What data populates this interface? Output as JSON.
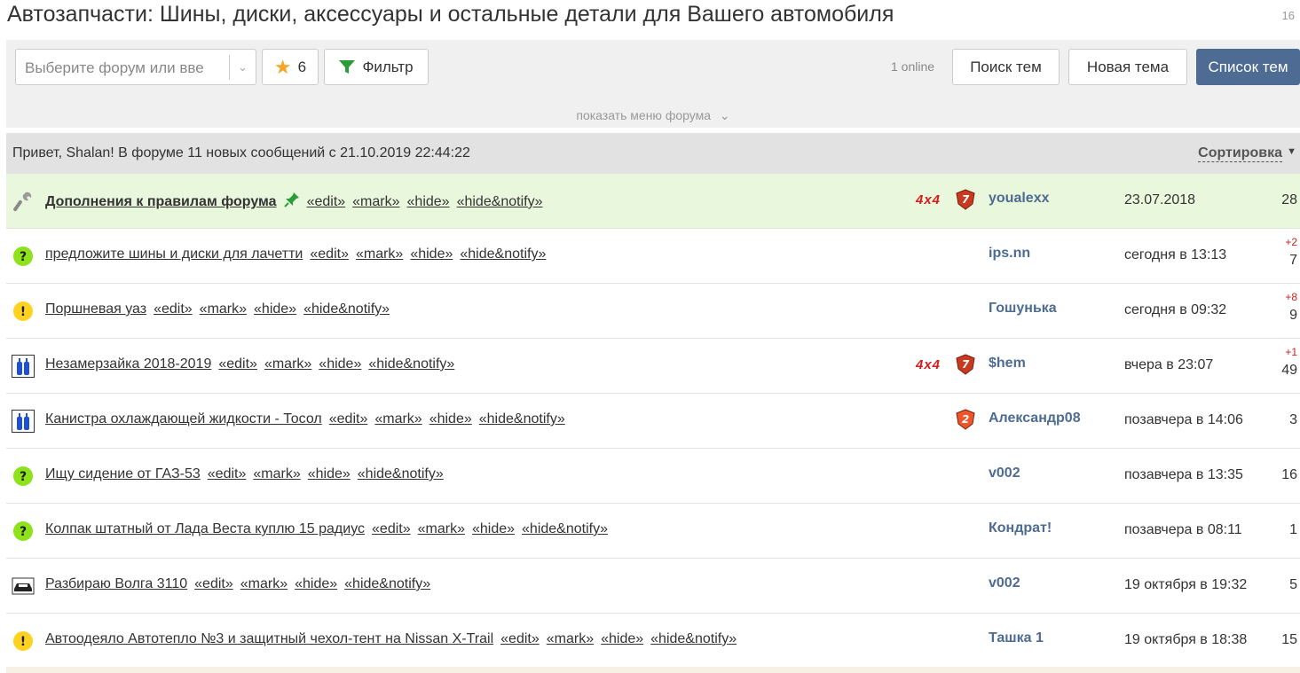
{
  "page": {
    "title": "Автозапчасти: Шины, диски, аксессуары и остальные детали для Вашего автомобиля",
    "counter": "16"
  },
  "toolbar": {
    "forum_select_placeholder": "Выберите форум или вве",
    "favorites_count": "6",
    "filter_label": "Фильтр",
    "online": "1 online",
    "search_label": "Поиск тем",
    "new_topic_label": "Новая тема",
    "topic_list_label": "Список тем"
  },
  "forum_menu_toggle": "показать меню форума",
  "greeting": "Привет, Shalan! В форуме 11 новых сообщений с 21.10.2019 22:44:22",
  "sort_label": "Сортировка",
  "actions": {
    "edit": "«edit»",
    "mark": "«mark»",
    "hide": "«hide»",
    "hide_notify": "«hide&notify»"
  },
  "colors": {
    "accent": "#4d6b93",
    "pinned_bg": "#e9f7dc",
    "new_count": "#d61d1d"
  },
  "topics": [
    {
      "icon": "wrench-icon",
      "title": "Дополнения к правилам форума",
      "pinned": true,
      "badge": "4x4",
      "rank": "7",
      "author": "youalexx",
      "date": "23.07.2018",
      "new": "",
      "count": "28"
    },
    {
      "icon": "question-icon",
      "title": "предложите шины и диски для лачетти",
      "pinned": false,
      "badge": "",
      "rank": "",
      "author": "ips.nn",
      "date": "сегодня в 13:13",
      "new": "+2",
      "count": "7"
    },
    {
      "icon": "exclamation-icon",
      "title": "Поршневая уаз",
      "pinned": false,
      "badge": "",
      "rank": "",
      "author": "Гошунька",
      "date": "сегодня в 09:32",
      "new": "+8",
      "count": "9"
    },
    {
      "icon": "bottles-icon",
      "title": "Незамерзайка 2018-2019",
      "pinned": false,
      "badge": "4x4",
      "rank": "7",
      "author": "$hem",
      "date": "вчера в 23:07",
      "new": "+1",
      "count": "49"
    },
    {
      "icon": "bottles-icon",
      "title": "Канистра охлаждающей жидкости - Тосол",
      "pinned": false,
      "badge": "",
      "rank": "2",
      "author": "Александр08",
      "date": "позавчера в 14:06",
      "new": "",
      "count": "3"
    },
    {
      "icon": "question-icon",
      "title": "Ищу сидение от ГАЗ-53",
      "pinned": false,
      "badge": "",
      "rank": "",
      "author": "v002",
      "date": "позавчера в 13:35",
      "new": "",
      "count": "16"
    },
    {
      "icon": "question-icon",
      "title": "Колпак штатный от Лада Веста куплю 15 радиус",
      "pinned": false,
      "badge": "",
      "rank": "",
      "author": "Кондрат!",
      "date": "позавчера в 08:11",
      "new": "",
      "count": "1"
    },
    {
      "icon": "car-icon",
      "title": "Разбираю Волга 3110",
      "pinned": false,
      "badge": "",
      "rank": "",
      "author": "v002",
      "date": "19 октября в 19:32",
      "new": "",
      "count": "5"
    },
    {
      "icon": "exclamation-icon",
      "title": "Автоодеяло Автотепло №3 и защитный чехол-тент на Nissan X-Trail",
      "pinned": false,
      "badge": "",
      "rank": "",
      "author": "Ташка 1",
      "date": "19 октября в 18:38",
      "new": "",
      "count": "15"
    }
  ]
}
